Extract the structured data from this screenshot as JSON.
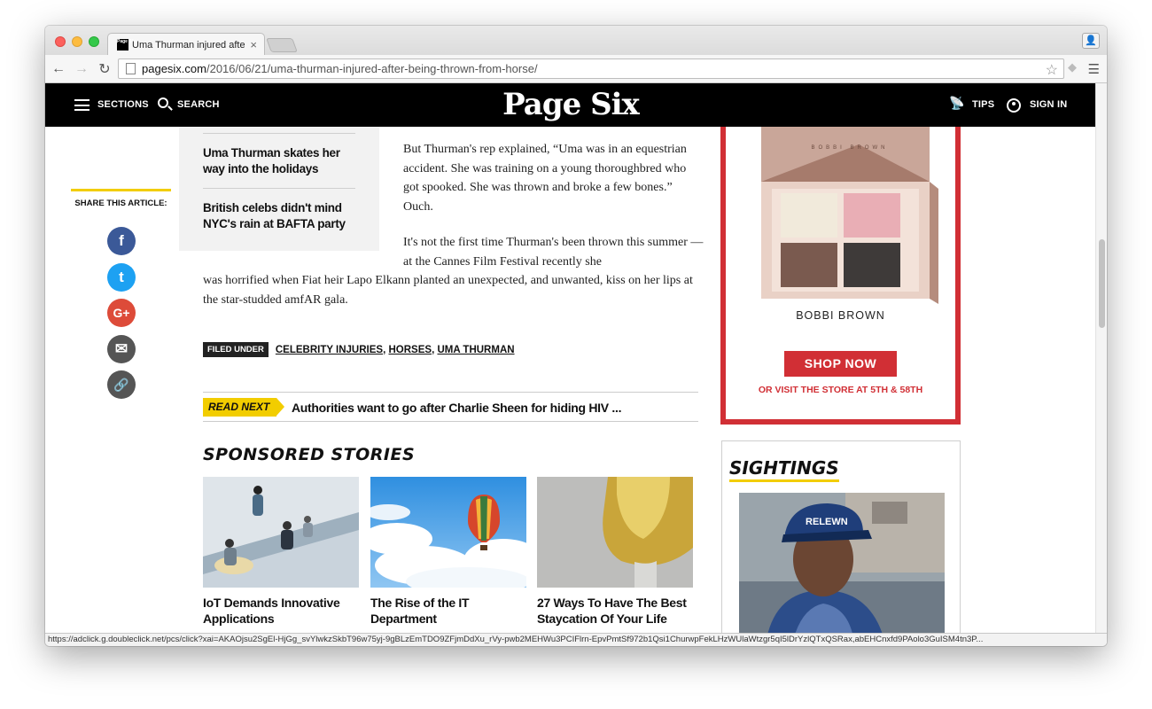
{
  "browser": {
    "tab_title": "Uma Thurman injured afte",
    "favicon_text": "Page Six",
    "close_glyph": "×",
    "url_host": "pagesix.com",
    "url_path": "/2016/06/21/uma-thurman-injured-after-being-thrown-from-horse/",
    "status_url": "https://adclick.g.doubleclick.net/pcs/click?xai=AKAOjsu2SgEl-HjGg_svYlwkzSkbT96w75yj-9gBLzEmTDO9ZFjmDdXu_rVy-pwb2MEHWu3PCIFlrn-EpvPmtSf972b1Qsi1ChurwpFekLHzWUlaWtzgr5qI5lDrYzlQTxQSRax,abEHCnxfd9PAolo3GuISM4tn3P..."
  },
  "header": {
    "sections_label": "SECTIONS",
    "search_label": "SEARCH",
    "logo": "Page Six",
    "tips_label": "TIPS",
    "signin_label": "SIGN IN"
  },
  "share": {
    "label": "SHARE THIS ARTICLE:",
    "buttons": [
      {
        "icon": "facebook-icon",
        "glyph": "f",
        "color": "#3b5998"
      },
      {
        "icon": "twitter-icon",
        "glyph": "t",
        "color": "#1da1f2"
      },
      {
        "icon": "google-plus-icon",
        "glyph": "G+",
        "color": "#dd4b39"
      },
      {
        "icon": "email-icon",
        "glyph": "✉",
        "color": "#555555"
      },
      {
        "icon": "link-icon",
        "glyph": "🔗",
        "color": "#555555"
      }
    ]
  },
  "related": [
    "Uma Thurman skates her way into the holidays",
    "British celebs didn't mind NYC's rain at BAFTA party"
  ],
  "article": {
    "para1": "But Thurman's rep explained, “Uma was in an equestrian accident. She was training on a young thoroughbred who got spooked. She was thrown and broke a few bones.” Ouch.",
    "para2a": "It's not the first time Thurman's been thrown this summer — at the Cannes Film Festival recently she",
    "para2b": "was horrified when Fiat heir Lapo Elkann planted an unexpected, and unwanted, kiss on her lips at the star-studded amfAR gala.",
    "filed_label": "FILED UNDER",
    "tags": [
      "CELEBRITY INJURIES",
      "HORSES",
      "UMA THURMAN"
    ],
    "tag_separator": ",",
    "read_next_label": "READ NEXT",
    "read_next_title": "Authorities want to go after Charlie Sheen for hiding HIV ..."
  },
  "sponsored": {
    "heading": "SPONSORED STORIES",
    "stories": [
      {
        "title": "IoT Demands Innovative Applications"
      },
      {
        "title": "The Rise of the IT Department"
      },
      {
        "title": "27 Ways To Have The Best Staycation Of Your Life"
      }
    ]
  },
  "ad": {
    "compact_brand": "BOBBI BROWN",
    "brand": "BOBBI BROWN",
    "cta": "SHOP NOW",
    "visit": "OR VISIT THE STORE AT 5TH & 58TH",
    "accent": "#d12f35"
  },
  "sightings": {
    "heading": "SIGHTINGS",
    "cap_text": "RELEWN"
  },
  "colors": {
    "yellow": "#f2cd00",
    "black": "#000000"
  }
}
